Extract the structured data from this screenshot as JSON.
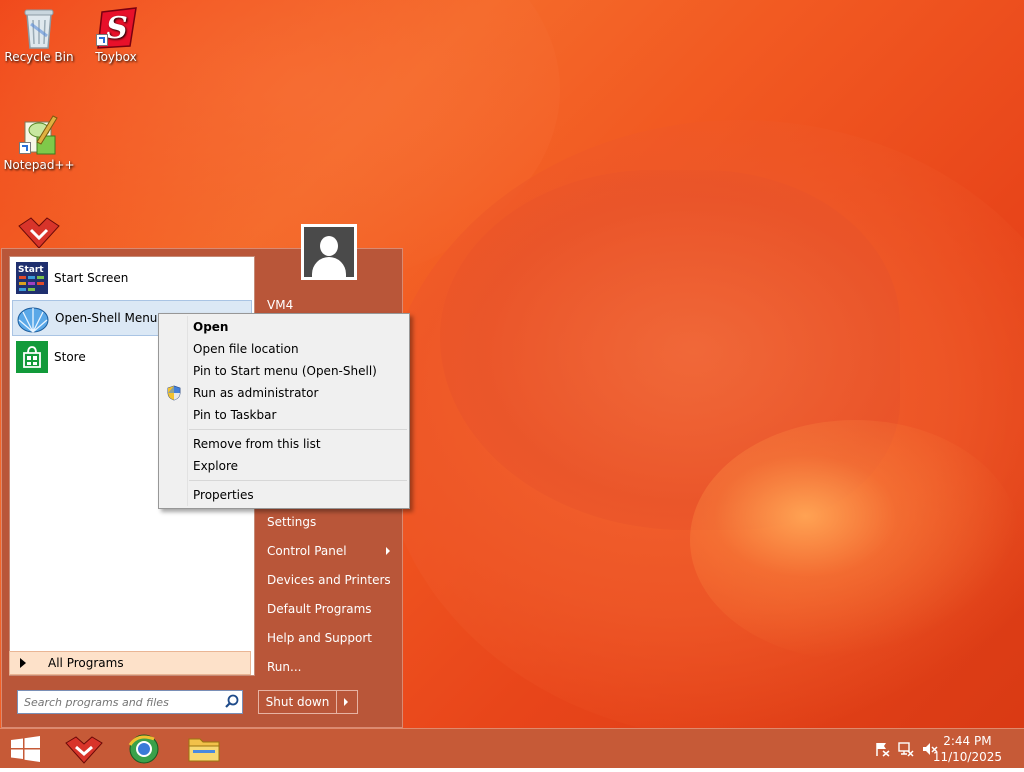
{
  "desktop": {
    "icons": [
      {
        "label": "Recycle Bin",
        "icon": "recycle-bin-icon"
      },
      {
        "label": "Toybox",
        "icon": "toybox-icon"
      },
      {
        "label": "Notepad++",
        "icon": "notepad-plus-plus-icon"
      },
      {
        "label": "",
        "icon": "app-icon"
      }
    ]
  },
  "start_menu": {
    "programs": [
      {
        "label": "Start Screen",
        "icon": "start-screen-icon",
        "icon_text": "Start"
      },
      {
        "label": "Open-Shell Menu Se",
        "icon": "open-shell-icon"
      },
      {
        "label": "Store",
        "icon": "store-icon"
      }
    ],
    "all_programs": "All Programs",
    "search_placeholder": "Search programs and files",
    "user_name": "VM4",
    "right_items": [
      {
        "label": "Settings"
      },
      {
        "label": "Control Panel",
        "has_submenu": true
      },
      {
        "label": "Devices and Printers"
      },
      {
        "label": "Default Programs"
      },
      {
        "label": "Help and Support"
      },
      {
        "label": "Run..."
      }
    ],
    "shutdown_label": "Shut down"
  },
  "context_menu": {
    "items": [
      {
        "label": "Open",
        "bold": true
      },
      {
        "label": "Open file location"
      },
      {
        "label": "Pin to Start menu (Open-Shell)"
      },
      {
        "label": "Run as administrator",
        "icon": "uac-shield-icon"
      },
      {
        "label": "Pin to Taskbar"
      },
      {
        "label": "Remove from this list"
      },
      {
        "label": "Explore"
      },
      {
        "label": "Properties"
      }
    ]
  },
  "taskbar": {
    "buttons": [
      "start-button",
      "toybox-taskbar-icon",
      "browser-taskbar-icon",
      "file-explorer-taskbar-icon"
    ],
    "time": "2:44 PM",
    "date": "11/10/2025"
  },
  "colors": {
    "wallpaper": "#f0471a",
    "start_menu_bg": "#b95639",
    "taskbar_bg": "#c65a37",
    "hover": "#dbe8f5"
  }
}
